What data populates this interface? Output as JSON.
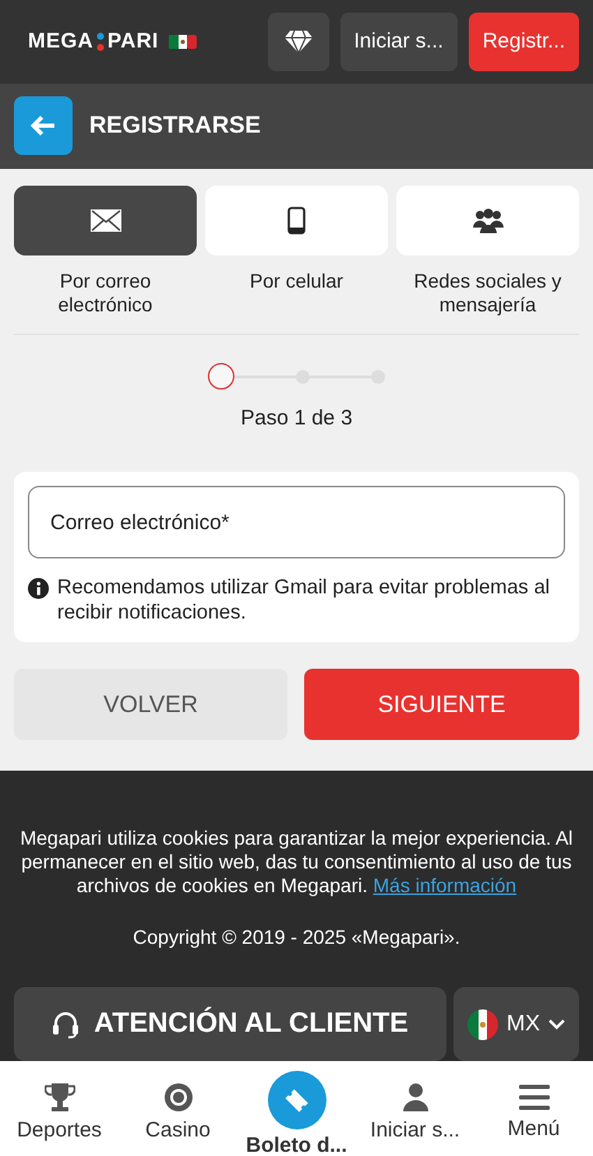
{
  "header": {
    "logo_left": "MEGA",
    "logo_right": "PARI",
    "login_button": "Iniciar s...",
    "register_button": "Registr..."
  },
  "page_title": "REGISTRARSE",
  "methods": [
    {
      "kind": "email",
      "label": "Por correo electrónico",
      "selected": true
    },
    {
      "kind": "phone",
      "label": "Por celular",
      "selected": false
    },
    {
      "kind": "social",
      "label": "Redes sociales y mensajería",
      "selected": false
    }
  ],
  "stepper": {
    "steps": [
      {
        "selected": true
      },
      {
        "selected": false
      },
      {
        "selected": false
      }
    ],
    "caption": "Paso 1 de 3"
  },
  "form": {
    "email_placeholder": "Correo electrónico*",
    "hint": "Recomendamos utilizar Gmail para evitar problemas al recibir notificaciones."
  },
  "buttons": {
    "back": "VOLVER",
    "next": "SIGUIENTE"
  },
  "footer": {
    "cookie_text": "Megapari utiliza cookies para garantizar la mejor experiencia. Al permanecer en el sitio web, das tu consentimiento al uso de tus archivos de cookies en Megapari.",
    "cookie_link": "Más información",
    "copyright": "Copyright © 2019 - 2025 «Megapari».",
    "support_button": "ATENCIÓN AL CLIENTE",
    "language": "MX"
  },
  "bottom_nav": [
    {
      "kind": "trophy",
      "label": "Deportes",
      "selected": false
    },
    {
      "kind": "chip",
      "label": "Casino",
      "selected": false
    },
    {
      "kind": "ticket",
      "label": "Boleto d...",
      "selected": true
    },
    {
      "kind": "user",
      "label": "Iniciar s...",
      "selected": false
    },
    {
      "kind": "menu",
      "label": "Menú",
      "selected": false
    }
  ]
}
